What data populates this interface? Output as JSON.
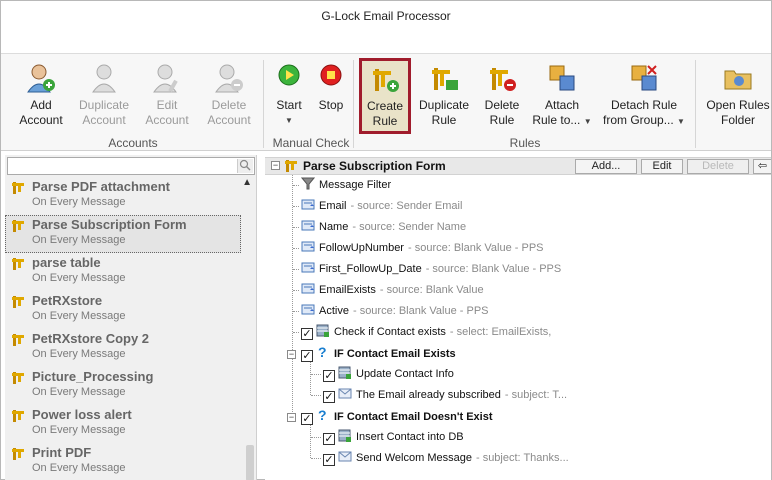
{
  "window": {
    "title": "G-Lock Email Processor"
  },
  "ribbon": {
    "groups": {
      "accounts": "Accounts",
      "manual_check": "Manual Check",
      "rules": "Rules"
    },
    "buttons": {
      "add_account": [
        "Add",
        "Account"
      ],
      "duplicate_account": [
        "Duplicate",
        "Account"
      ],
      "edit_account": [
        "Edit",
        "Account"
      ],
      "delete_account": [
        "Delete",
        "Account"
      ],
      "start": [
        "Start"
      ],
      "stop": [
        "Stop"
      ],
      "create_rule": [
        "Create",
        "Rule"
      ],
      "duplicate_rule": [
        "Duplicate",
        "Rule"
      ],
      "delete_rule": [
        "Delete",
        "Rule"
      ],
      "attach_rule": [
        "Attach",
        "Rule to..."
      ],
      "detach_rule": [
        "Detach Rule",
        "from Group..."
      ],
      "open_rules_folder": [
        "Open Rules",
        "Folder"
      ]
    }
  },
  "rules_list": {
    "search_placeholder": "",
    "items": [
      {
        "name": "Parse PDF attachment",
        "trigger": "On Every Message"
      },
      {
        "name": "Parse Subscription Form",
        "trigger": "On Every Message",
        "selected": true
      },
      {
        "name": "parse table",
        "trigger": "On Every Message"
      },
      {
        "name": "PetRXstore",
        "trigger": "On Every Message"
      },
      {
        "name": "PetRXstore Copy 2",
        "trigger": "On Every Message"
      },
      {
        "name": "Picture_Processing",
        "trigger": "On Every Message"
      },
      {
        "name": "Power loss alert",
        "trigger": "On Every Message"
      },
      {
        "name": "Print PDF",
        "trigger": "On Every Message"
      }
    ]
  },
  "rule_editor": {
    "title": "Parse Subscription Form",
    "buttons": {
      "add": "Add...",
      "edit": "Edit",
      "delete": "Delete"
    },
    "nodes": [
      {
        "label": "Message Filter",
        "detail": ""
      },
      {
        "label": "Email",
        "detail": "- source: Sender Email"
      },
      {
        "label": "Name",
        "detail": "- source: Sender Name"
      },
      {
        "label": "FollowUpNumber",
        "detail": "- source: Blank Value - PPS"
      },
      {
        "label": "First_FollowUp_Date",
        "detail": "- source: Blank Value - PPS"
      },
      {
        "label": "EmailExists",
        "detail": "- source: Blank Value"
      },
      {
        "label": "Active",
        "detail": "- source: Blank Value - PPS"
      },
      {
        "label": "Check if Contact exists",
        "detail": "- select: EmailExists,"
      },
      {
        "label": "IF Contact Email Exists",
        "detail": ""
      },
      {
        "label": "Update Contact Info",
        "detail": ""
      },
      {
        "label": "The Email already subscribed",
        "detail": "- subject: T..."
      },
      {
        "label": "IF Contact Email Doesn't Exist",
        "detail": ""
      },
      {
        "label": "Insert Contact into DB",
        "detail": ""
      },
      {
        "label": "Send Welcom Message",
        "detail": "- subject: Thanks..."
      }
    ]
  },
  "colors": {
    "selected_border": "#a01c2c",
    "rule_icon": "#d9a400",
    "check_icon": "#1a7fd0"
  }
}
